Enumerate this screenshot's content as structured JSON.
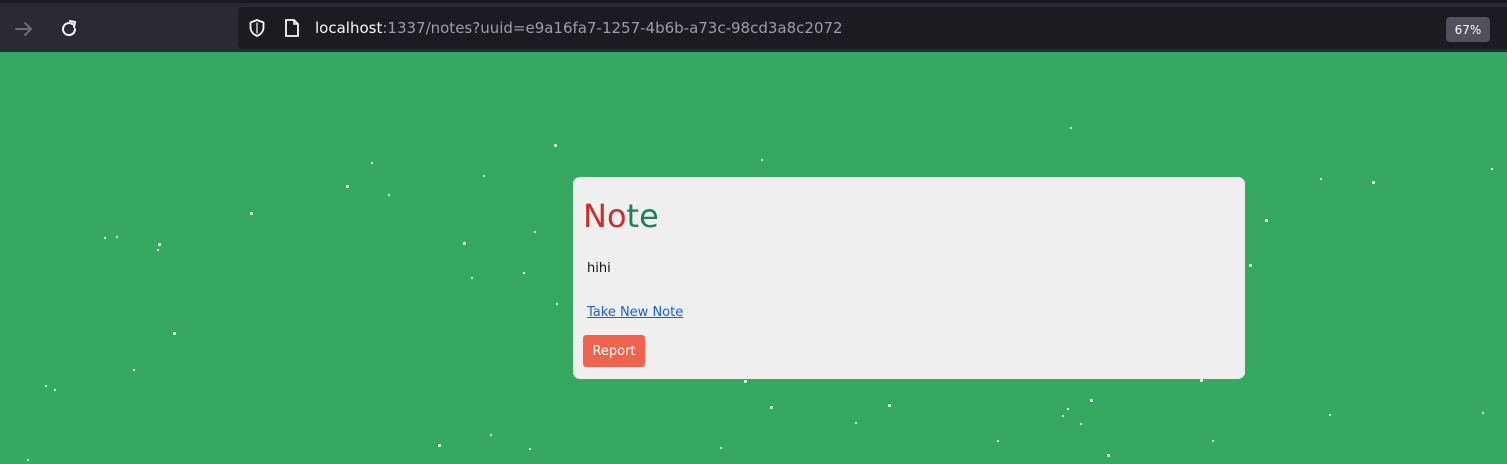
{
  "browser": {
    "url_host": "localhost",
    "url_rest": ":1337/notes?uuid=e9a16fa7-1257-4b6b-a73c-98cd3a8c2072",
    "zoom": "67%",
    "forward_icon": "arrow-right-icon",
    "reload_icon": "reload-icon",
    "shield_icon": "shield-icon",
    "page_icon": "page-icon"
  },
  "page": {
    "background_color": "#36a862"
  },
  "note": {
    "title_letters": [
      "N",
      "o",
      "t",
      "e"
    ],
    "title_colors": [
      "#c8302c",
      "#c8302c",
      "#1b7f5a",
      "#1b7f5a"
    ],
    "body": "hihi",
    "new_note_link": "Take New Note",
    "report_button": "Report",
    "report_color": "#f0634f"
  }
}
